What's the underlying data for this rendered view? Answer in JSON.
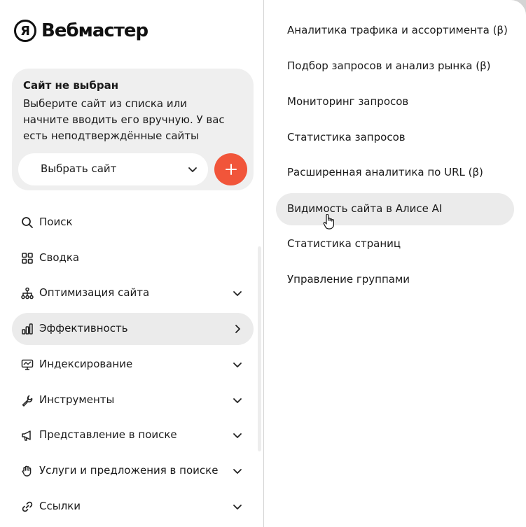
{
  "logo": {
    "mark": "Я",
    "text": "Вебмастер"
  },
  "site_card": {
    "title": "Сайт не выбран",
    "description": "Выберите сайт из списка или начните вводить его вручную. У вас есть неподтверждённые сайты",
    "select_label": "Выбрать сайт",
    "add_button_icon": "plus-icon",
    "add_button_color": "#f1553a"
  },
  "nav": {
    "items": [
      {
        "label": "Поиск",
        "icon": "search-icon"
      },
      {
        "label": "Сводка",
        "icon": "grid-icon"
      },
      {
        "label": "Оптимизация сайта",
        "icon": "sitemap-icon",
        "chevron": "chevron-down-icon"
      },
      {
        "label": "Эффективность",
        "icon": "bar-chart-icon",
        "chevron": "chevron-right-icon",
        "active": true
      },
      {
        "label": "Индексирование",
        "icon": "monitor-icon",
        "chevron": "chevron-down-icon"
      },
      {
        "label": "Инструменты",
        "icon": "wrench-icon",
        "chevron": "chevron-down-icon"
      },
      {
        "label": "Представление в поиске",
        "icon": "megaphone-icon",
        "chevron": "chevron-down-icon"
      },
      {
        "label": "Услуги и предложения в поиске",
        "icon": "hand-icon",
        "chevron": "chevron-down-icon"
      },
      {
        "label": "Ссылки",
        "icon": "link-icon",
        "chevron": "chevron-down-icon"
      }
    ]
  },
  "submenu": {
    "items": [
      {
        "label": "Аналитика трафика и ассортимента (β)"
      },
      {
        "label": "Подбор запросов и анализ рынка (β)"
      },
      {
        "label": "Мониторинг запросов"
      },
      {
        "label": "Статистика запросов"
      },
      {
        "label": "Расширенная аналитика по URL (β)"
      },
      {
        "label": "Видимость сайта в Алисе AI",
        "hovered": true
      },
      {
        "label": "Статистика страниц"
      },
      {
        "label": "Управление группами"
      }
    ]
  }
}
